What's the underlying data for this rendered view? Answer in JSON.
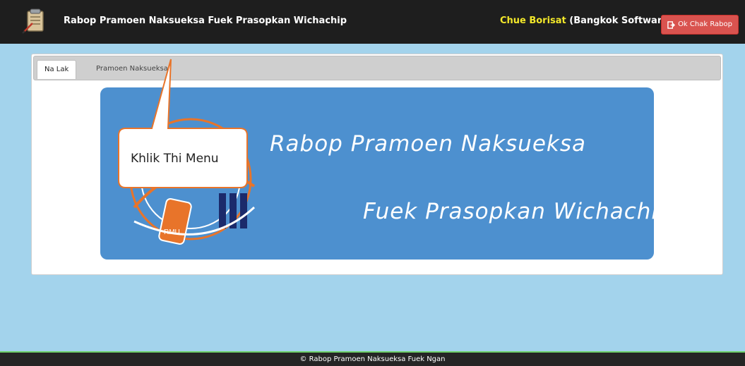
{
  "header": {
    "app_title": "Rabop Pramoen Naksueksa Fuek Prasopkan Wichachip",
    "company_label": "Chue Borisat",
    "company_name": "(Bangkok Software)",
    "logout_label": "Ok Chak Rabop"
  },
  "tabs": [
    {
      "label": "Na Lak",
      "active": true
    },
    {
      "label": "Pramoen Naksueksa",
      "active": false
    }
  ],
  "banner": {
    "line1": "Rabop Pramoen Naksueksa",
    "line2": "Fuek Prasopkan Wichachip",
    "logo_text_top": "RMU",
    "logo_text_bottom": "RMU"
  },
  "callout": {
    "text": "Khlik Thi Menu"
  },
  "footer": {
    "text": "© Rabop Pramoen Naksueksa Fuek Ngan"
  },
  "colors": {
    "topbar": "#1e1e1e",
    "page_bg": "#a3d3ec",
    "banner_bg": "#4d90cf",
    "company_label": "#f3e82a",
    "logout_button": "#d9534f",
    "footer_accent": "#6fd26a",
    "logo_orange": "#e8742a"
  },
  "icons": {
    "brand": "notepad-icon",
    "logout": "sign-out-icon"
  }
}
